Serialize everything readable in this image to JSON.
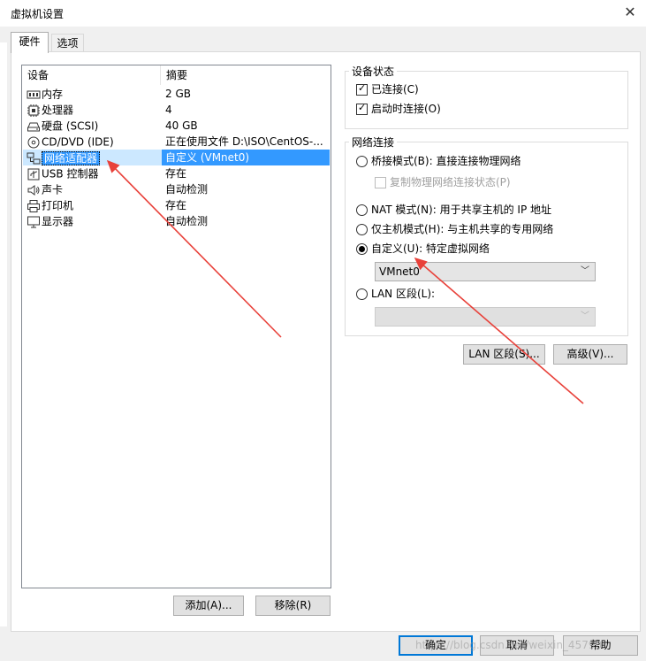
{
  "window": {
    "title": "虚拟机设置",
    "close_glyph": "✕"
  },
  "tabs": [
    {
      "label": "硬件",
      "active": true
    },
    {
      "label": "选项",
      "active": false
    }
  ],
  "device_list": {
    "headers": {
      "device": "设备",
      "summary": "摘要"
    },
    "rows": [
      {
        "device": "内存",
        "summary": "2 GB",
        "icon": "memory-icon"
      },
      {
        "device": "处理器",
        "summary": "4",
        "icon": "cpu-icon"
      },
      {
        "device": "硬盘 (SCSI)",
        "summary": "40 GB",
        "icon": "hard-disk-icon"
      },
      {
        "device": "CD/DVD (IDE)",
        "summary": "正在使用文件 D:\\ISO\\CentOS-...",
        "icon": "cd-dvd-icon"
      },
      {
        "device": "网络适配器",
        "summary": "自定义 (VMnet0)",
        "icon": "network-adapter-icon",
        "selected": true
      },
      {
        "device": "USB 控制器",
        "summary": "存在",
        "icon": "usb-icon"
      },
      {
        "device": "声卡",
        "summary": "自动检测",
        "icon": "speaker-icon"
      },
      {
        "device": "打印机",
        "summary": "存在",
        "icon": "printer-icon"
      },
      {
        "device": "显示器",
        "summary": "自动检测",
        "icon": "monitor-icon"
      }
    ]
  },
  "left_buttons": {
    "add": "添加(A)...",
    "remove": "移除(R)"
  },
  "device_status": {
    "title": "设备状态",
    "connected": {
      "label": "已连接(C)",
      "checked": true
    },
    "connect_at_power_on": {
      "label": "启动时连接(O)",
      "checked": true
    }
  },
  "network_connection": {
    "title": "网络连接",
    "bridged": {
      "label": "桥接模式(B): 直接连接物理网络",
      "selected": false
    },
    "replicate": {
      "label": "复制物理网络连接状态(P)",
      "checked": false,
      "enabled": false
    },
    "nat": {
      "label": "NAT 模式(N): 用于共享主机的 IP 地址",
      "selected": false
    },
    "host_only": {
      "label": "仅主机模式(H): 与主机共享的专用网络",
      "selected": false
    },
    "custom": {
      "label": "自定义(U): 特定虚拟网络",
      "selected": true
    },
    "custom_select": {
      "value": "VMnet0"
    },
    "lan_segment": {
      "label": "LAN 区段(L):",
      "selected": false
    },
    "lan_select": {
      "value": ""
    }
  },
  "right_buttons": {
    "lan_segments": "LAN 区段(S)...",
    "advanced": "高级(V)..."
  },
  "footer_buttons": {
    "ok": "确定",
    "cancel": "取消",
    "help": "帮助"
  },
  "watermark": "https://blog.csdn.net/weixin_45790",
  "colors": {
    "selection": "#3399ff",
    "annotation_arrow": "#e8413a",
    "default_button_border": "#0078d7"
  }
}
